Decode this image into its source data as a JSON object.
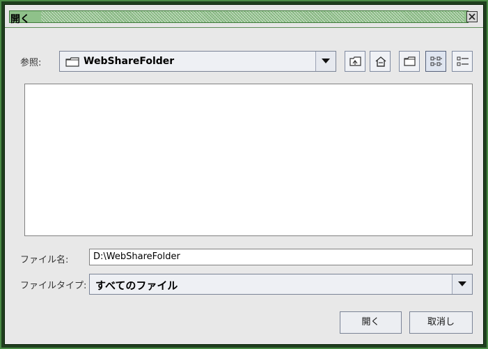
{
  "window": {
    "title": "開く"
  },
  "look_in": {
    "label": "参照:",
    "value": "WebShareFolder"
  },
  "toolbar": {
    "buttons": [
      {
        "name": "up-one-level",
        "icon": "folder-up-icon"
      },
      {
        "name": "home",
        "icon": "home-icon"
      },
      {
        "name": "new-folder",
        "icon": "new-folder-icon"
      },
      {
        "name": "list-view",
        "icon": "list-view-icon"
      },
      {
        "name": "details-view",
        "icon": "details-view-icon"
      }
    ]
  },
  "file_name": {
    "label": "ファイル名:",
    "value": "D:\\WebShareFolder"
  },
  "file_type": {
    "label": "ファイルタイプ:",
    "value": "すべてのファイル"
  },
  "buttons": {
    "open": "開く",
    "cancel": "取消し"
  },
  "colors": {
    "frame": "#4b8c46",
    "titlebar": "#8fc18a",
    "dialog_bg": "#e8e8e8"
  }
}
